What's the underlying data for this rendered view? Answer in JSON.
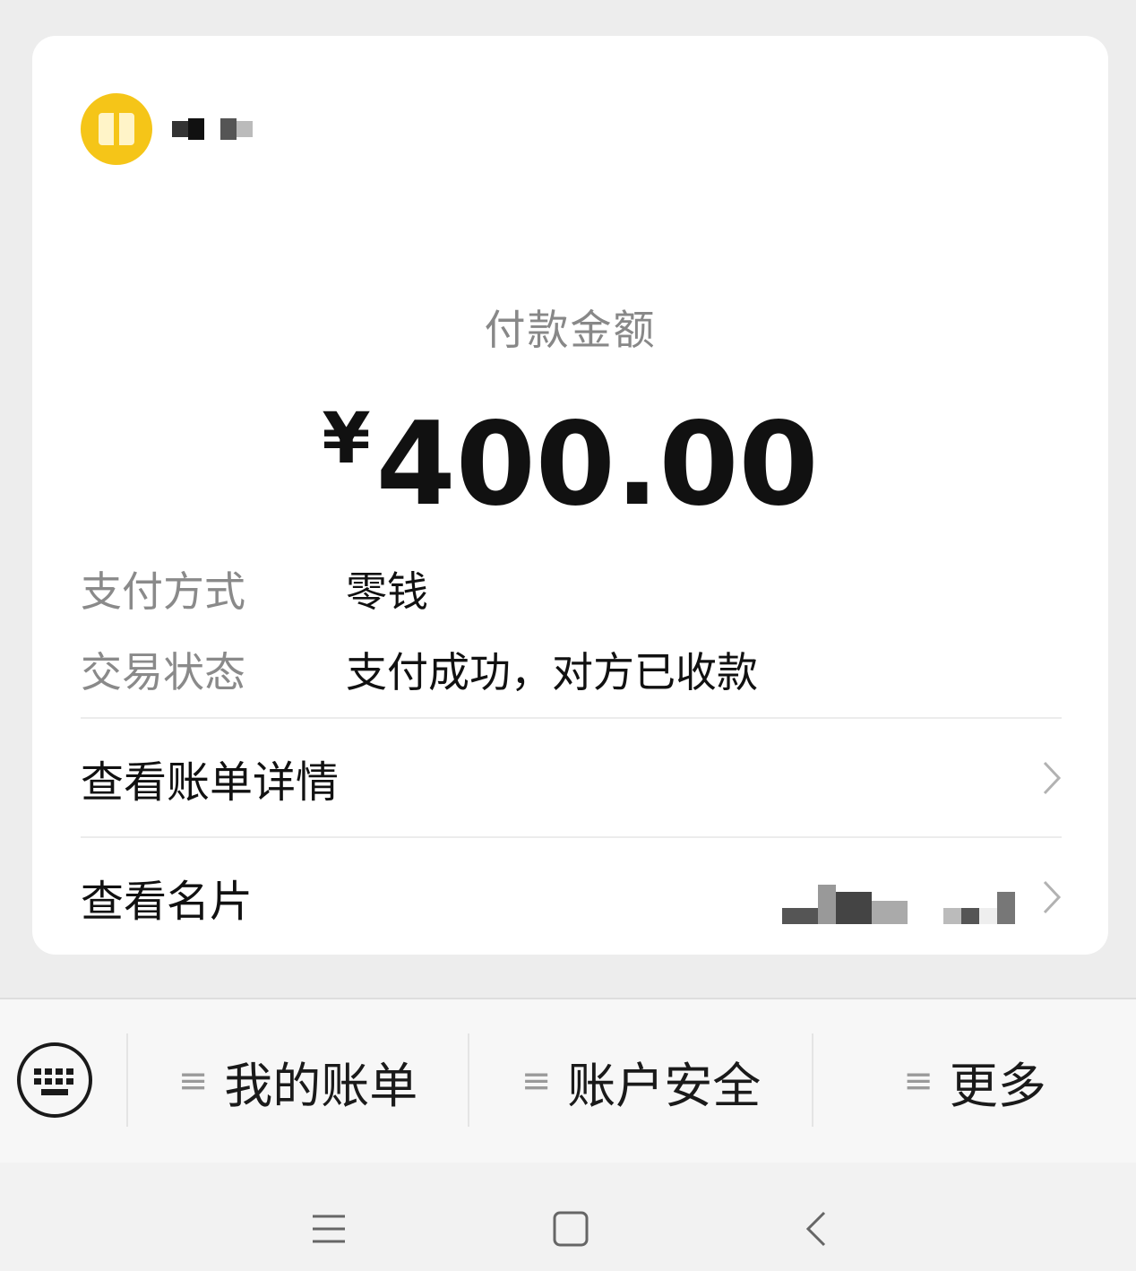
{
  "receipt": {
    "amount_label": "付款金额",
    "currency_symbol": "¥",
    "amount": "400.00",
    "details": [
      {
        "label": "支付方式",
        "value": "零钱"
      },
      {
        "label": "交易状态",
        "value": "支付成功，对方已收款"
      }
    ],
    "links": {
      "bill_details": "查看账单详情",
      "view_card": "查看名片"
    }
  },
  "menu": {
    "items": [
      "我的账单",
      "账户安全",
      "更多"
    ],
    "menu_glyph": "≡"
  },
  "icons": {
    "merchant": "gift-icon",
    "chevron": "chevron-right-icon",
    "keyboard": "keyboard-icon",
    "nav_menu": "menu-icon",
    "nav_home": "home-icon",
    "nav_back": "back-icon"
  },
  "colors": {
    "logo": "#f5c518",
    "background": "#ededed",
    "card": "#ffffff"
  }
}
